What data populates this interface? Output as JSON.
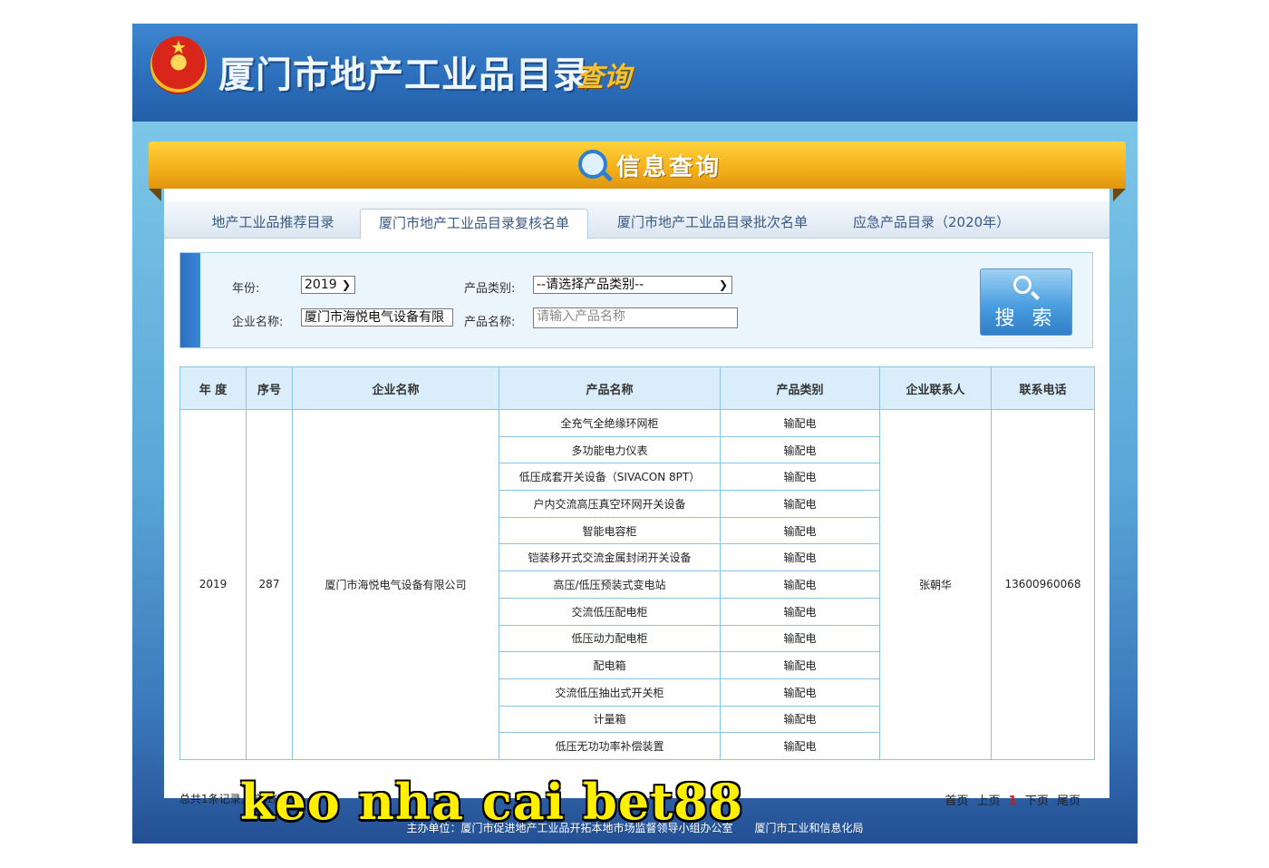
{
  "header": {
    "title": "厦门市地产工业品目录",
    "subtitle": "查询",
    "emblem_icon": "national-emblem-icon"
  },
  "banner": {
    "title": "信息查询",
    "icon": "magnifier-icon"
  },
  "tabs": [
    {
      "label": "地产工业品推荐目录",
      "active": false
    },
    {
      "label": "厦门市地产工业品目录复核名单",
      "active": true
    },
    {
      "label": "厦门市地产工业品目录批次名单",
      "active": false
    },
    {
      "label": "应急产品目录（2020年）",
      "active": false
    }
  ],
  "form": {
    "year_label": "年份:",
    "year_value": "2019",
    "company_label": "企业名称:",
    "company_value": "厦门市海悦电气设备有限",
    "category_label": "产品类别:",
    "category_value": "--请选择产品类别--",
    "product_label": "产品名称:",
    "product_placeholder": "请输入产品名称",
    "search_label": "搜 索"
  },
  "table": {
    "headers": [
      "年 度",
      "序号",
      "企业名称",
      "产品名称",
      "产品类别",
      "企业联系人",
      "联系电话"
    ],
    "year": "2019",
    "seq": "287",
    "company": "厦门市海悦电气设备有限公司",
    "contact": "张朝华",
    "phone": "13600960068",
    "products": [
      {
        "name": "全充气全绝缘环网柜",
        "category": "输配电"
      },
      {
        "name": "多功能电力仪表",
        "category": "输配电"
      },
      {
        "name": "低压成套开关设备（SIVACON 8PT）",
        "category": "输配电"
      },
      {
        "name": "户内交流高压真空环网开关设备",
        "category": "输配电"
      },
      {
        "name": "智能电容柜",
        "category": "输配电"
      },
      {
        "name": "铠装移开式交流金属封闭开关设备",
        "category": "输配电"
      },
      {
        "name": "高压/低压预装式变电站",
        "category": "输配电"
      },
      {
        "name": "交流低压配电柜",
        "category": "输配电"
      },
      {
        "name": "低压动力配电柜",
        "category": "输配电"
      },
      {
        "name": "配电箱",
        "category": "输配电"
      },
      {
        "name": "交流低压抽出式开关柜",
        "category": "输配电"
      },
      {
        "name": "计量箱",
        "category": "输配电"
      },
      {
        "name": "低压无功功率补偿装置",
        "category": "输配电"
      }
    ]
  },
  "summary": "总共1条记录,目前1/1",
  "pager": {
    "first": "首页",
    "prev": "上页",
    "current": "1",
    "next": "下页",
    "last": "尾页"
  },
  "footer": "主办单位：厦门市促进地产工业品开拓本地市场监督领导小组办公室　　厦门市工业和信息化局",
  "overlay_text": "keo nha cai bet88"
}
